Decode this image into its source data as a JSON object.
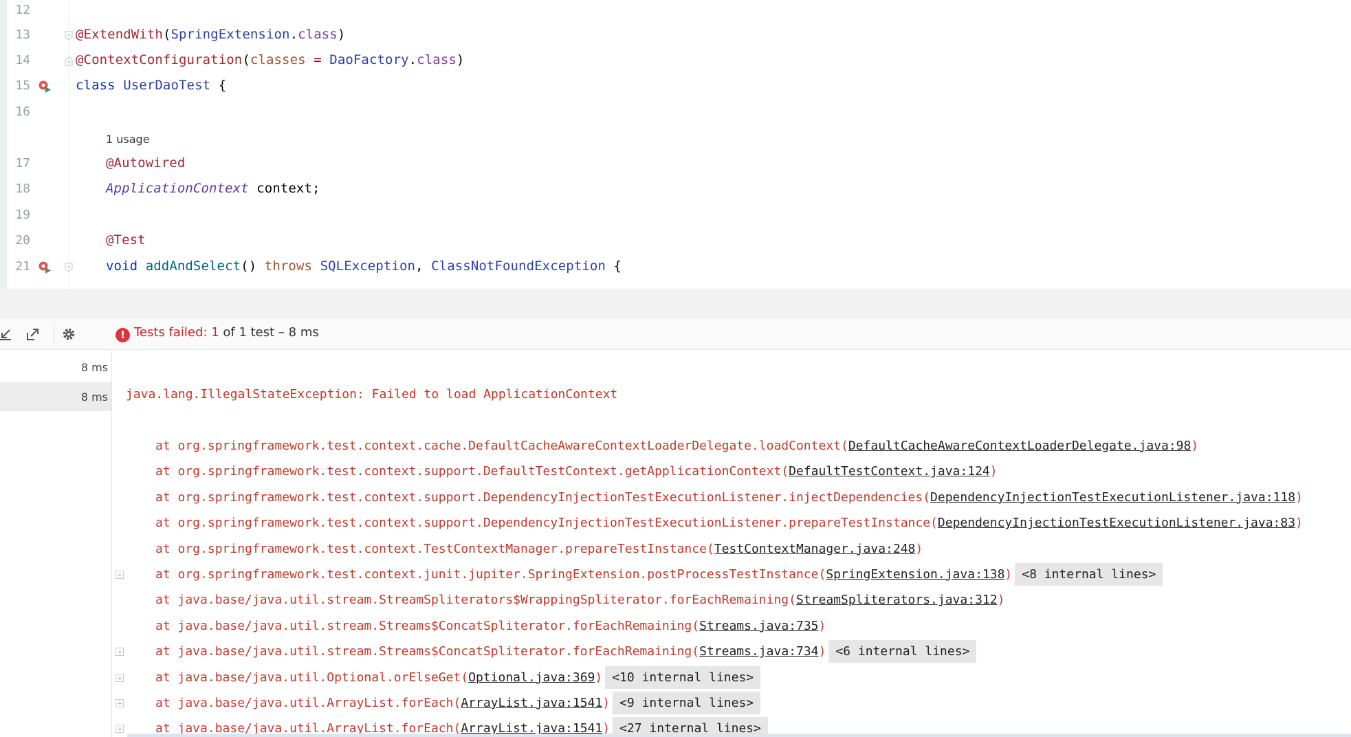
{
  "editor": {
    "lines": [
      {
        "num": "12"
      },
      {
        "num": "13",
        "anno": "@ExtendWith",
        "p1": "(",
        "cls": "SpringExtension",
        "dot": ".",
        "kw": "class",
        "p2": ")"
      },
      {
        "num": "14",
        "anno": "@ContextConfiguration",
        "p1": "(",
        "param": "classes",
        "eq": " = ",
        "cls": "DaoFactory",
        "dot": ".",
        "kw": "class",
        "p2": ")"
      },
      {
        "num": "15",
        "kw": "class ",
        "cls": "UserDaoTest",
        "rest": " {"
      },
      {
        "num": "16"
      },
      {
        "usage": "1 usage"
      },
      {
        "num": "17",
        "anno": "@Autowired"
      },
      {
        "num": "18",
        "type": "ApplicationContext",
        "rest": " context;"
      },
      {
        "num": "19"
      },
      {
        "num": "20",
        "anno": "@Test"
      },
      {
        "num": "21",
        "kw": "void ",
        "fn": "addAndSelect",
        "p": "() ",
        "kw2": "throws ",
        "ex1": "SQLException",
        "comma": ", ",
        "ex2": "ClassNotFoundException",
        "rest": " {"
      }
    ]
  },
  "toolbar": {
    "status_prefix": "Tests failed: ",
    "failed_count": "1",
    "of_text": " of ",
    "total_count": "1",
    "suffix": " test – 8 ms",
    "icons": [
      "collapse-icon",
      "export-icon",
      "gear-icon",
      "error-icon"
    ]
  },
  "tree": {
    "rows": [
      {
        "duration": "8 ms"
      },
      {
        "duration": "8 ms"
      }
    ]
  },
  "console": {
    "exception": "java.lang.IllegalStateException: Failed to load ApplicationContext",
    "frames": [
      {
        "text": "at org.springframework.test.context.cache.DefaultCacheAwareContextLoaderDelegate.loadContext(",
        "link": "DefaultCacheAwareContextLoaderDelegate.java:98",
        "close": ")",
        "internal": ""
      },
      {
        "text": "at org.springframework.test.context.support.DefaultTestContext.getApplicationContext(",
        "link": "DefaultTestContext.java:124",
        "close": ")",
        "internal": ""
      },
      {
        "text": "at org.springframework.test.context.support.DependencyInjectionTestExecutionListener.injectDependencies(",
        "link": "DependencyInjectionTestExecutionListener.java:118",
        "close": ")",
        "internal": ""
      },
      {
        "text": "at org.springframework.test.context.support.DependencyInjectionTestExecutionListener.prepareTestInstance(",
        "link": "DependencyInjectionTestExecutionListener.java:83",
        "close": ")",
        "internal": ""
      },
      {
        "text": "at org.springframework.test.context.TestContextManager.prepareTestInstance(",
        "link": "TestContextManager.java:248",
        "close": ")",
        "internal": ""
      },
      {
        "text": "at org.springframework.test.context.junit.jupiter.SpringExtension.postProcessTestInstance(",
        "link": "SpringExtension.java:138",
        "close": ")",
        "internal": "<8 internal lines>"
      },
      {
        "text": "at java.base/java.util.stream.StreamSpliterators$WrappingSpliterator.forEachRemaining(",
        "link": "StreamSpliterators.java:312",
        "close": ")",
        "internal": ""
      },
      {
        "text": "at java.base/java.util.stream.Streams$ConcatSpliterator.forEachRemaining(",
        "link": "Streams.java:735",
        "close": ")",
        "internal": ""
      },
      {
        "text": "at java.base/java.util.stream.Streams$ConcatSpliterator.forEachRemaining(",
        "link": "Streams.java:734",
        "close": ")",
        "internal": "<6 internal lines>"
      },
      {
        "text": "at java.base/java.util.Optional.orElseGet(",
        "link": "Optional.java:369",
        "close": ")",
        "internal": "<10 internal lines>"
      },
      {
        "text": "at java.base/java.util.ArrayList.forEach(",
        "link": "ArrayList.java:1541",
        "close": ")",
        "internal": "<9 internal lines>"
      },
      {
        "text": "at java.base/java.util.ArrayList.forEach(",
        "link": "ArrayList.java:1541",
        "close": ")",
        "internal": "<27 internal lines>"
      }
    ]
  }
}
